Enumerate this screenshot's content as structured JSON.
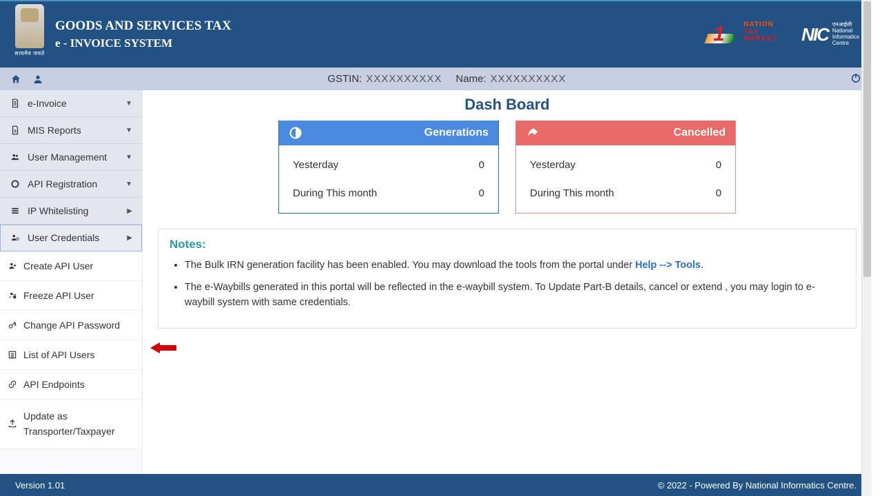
{
  "header": {
    "title_line1": "GOODS AND SERVICES TAX",
    "title_line2": "e - INVOICE SYSTEM",
    "emblem_motto": "सत्यमेव जयते",
    "tax_market": {
      "w1": "NATION",
      "w2": "TAX",
      "w3": "MARKET"
    },
    "nic": {
      "logo": "NIC",
      "hi": "एनआईसी",
      "l1": "National",
      "l2": "Informatics",
      "l3": "Centre"
    }
  },
  "infobar": {
    "gstin_label": "GSTIN:",
    "gstin_value": "XXXXXXXXXX",
    "name_label": "Name:",
    "name_value": "XXXXXXXXXX"
  },
  "sidebar": {
    "items": [
      {
        "icon": "file",
        "label": "e-Invoice",
        "caret": "down"
      },
      {
        "icon": "file",
        "label": "MIS Reports",
        "caret": "down"
      },
      {
        "icon": "users",
        "label": "User Management",
        "caret": "down"
      },
      {
        "icon": "ring",
        "label": "API Registration",
        "caret": "down"
      },
      {
        "icon": "list",
        "label": "IP Whitelisting",
        "caret": "right"
      },
      {
        "icon": "user-cog",
        "label": "User Credentials",
        "caret": "right",
        "selected": true
      }
    ],
    "subitems": [
      {
        "icon": "user-plus",
        "label": "Create API User"
      },
      {
        "icon": "user-lock",
        "label": "Freeze API User"
      },
      {
        "icon": "key",
        "label": "Change API Password"
      },
      {
        "icon": "list-box",
        "label": "List of API Users"
      },
      {
        "icon": "link",
        "label": "API Endpoints"
      },
      {
        "icon": "upload",
        "label": "Update as Transporter/Taxpayer"
      }
    ]
  },
  "main": {
    "title": "Dash Board",
    "cards": {
      "generations": {
        "title": "Generations",
        "rows": [
          {
            "label": "Yesterday",
            "value": "0"
          },
          {
            "label": "During This month",
            "value": "0"
          }
        ]
      },
      "cancelled": {
        "title": "Cancelled",
        "rows": [
          {
            "label": "Yesterday",
            "value": "0"
          },
          {
            "label": "During This month",
            "value": "0"
          }
        ]
      }
    },
    "notes": {
      "title": "Notes:",
      "n1a": "The Bulk IRN generation facility has been enabled. You may download the tools from the portal under ",
      "n1link": "Help --> Tools",
      "n1b": ".",
      "n2": "The e-Waybills generated in this portal will be reflected in the e-waybill system. To Update Part-B details, cancel or extend , you may login to e-waybill system with same credentials."
    }
  },
  "footer": {
    "version": "Version 1.01",
    "copyright": "© 2022 - Powered By National Informatics Centre."
  }
}
